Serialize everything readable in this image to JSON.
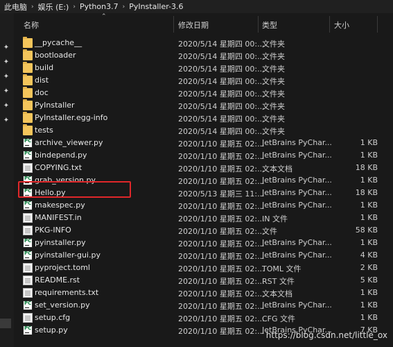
{
  "breadcrumb": [
    "此电脑",
    "娱乐 (E:)",
    "Python3.7",
    "PyInstaller-3.6"
  ],
  "header": {
    "name": "名称",
    "date": "修改日期",
    "type": "类型",
    "size": "大小"
  },
  "files": [
    {
      "name": "__pycache__",
      "date": "2020/5/14 星期四 00:...",
      "type": "文件夹",
      "size": "",
      "icon": "folder-icon"
    },
    {
      "name": "bootloader",
      "date": "2020/5/14 星期四 00:...",
      "type": "文件夹",
      "size": "",
      "icon": "folder-icon"
    },
    {
      "name": "build",
      "date": "2020/5/14 星期四 00:...",
      "type": "文件夹",
      "size": "",
      "icon": "folder-icon"
    },
    {
      "name": "dist",
      "date": "2020/5/14 星期四 00:...",
      "type": "文件夹",
      "size": "",
      "icon": "folder-icon"
    },
    {
      "name": "doc",
      "date": "2020/5/14 星期四 00:...",
      "type": "文件夹",
      "size": "",
      "icon": "folder-icon"
    },
    {
      "name": "PyInstaller",
      "date": "2020/5/14 星期四 00:...",
      "type": "文件夹",
      "size": "",
      "icon": "folder-icon"
    },
    {
      "name": "PyInstaller.egg-info",
      "date": "2020/5/14 星期四 00:...",
      "type": "文件夹",
      "size": "",
      "icon": "folder-icon"
    },
    {
      "name": "tests",
      "date": "2020/5/14 星期四 00:...",
      "type": "文件夹",
      "size": "",
      "icon": "folder-icon"
    },
    {
      "name": "archive_viewer.py",
      "date": "2020/1/10 星期五 02:...",
      "type": "JetBrains PyChar...",
      "size": "1 KB",
      "icon": "pycharm-file-icon"
    },
    {
      "name": "bindepend.py",
      "date": "2020/1/10 星期五 02:...",
      "type": "JetBrains PyChar...",
      "size": "1 KB",
      "icon": "pycharm-file-icon"
    },
    {
      "name": "COPYING.txt",
      "date": "2020/1/10 星期五 02:...",
      "type": "文本文档",
      "size": "18 KB",
      "icon": "text-file-icon"
    },
    {
      "name": "grab_version.py",
      "date": "2020/1/10 星期五 02:...",
      "type": "JetBrains PyChar...",
      "size": "1 KB",
      "icon": "pycharm-file-icon"
    },
    {
      "name": "Hello.py",
      "date": "2020/5/13 星期三 11:...",
      "type": "JetBrains PyChar...",
      "size": "18 KB",
      "icon": "pycharm-file-icon"
    },
    {
      "name": "makespec.py",
      "date": "2020/1/10 星期五 02:...",
      "type": "JetBrains PyChar...",
      "size": "1 KB",
      "icon": "pycharm-file-icon"
    },
    {
      "name": "MANIFEST.in",
      "date": "2020/1/10 星期五 02:...",
      "type": "IN 文件",
      "size": "1 KB",
      "icon": "document-icon"
    },
    {
      "name": "PKG-INFO",
      "date": "2020/1/10 星期五 02:...",
      "type": "文件",
      "size": "58 KB",
      "icon": "document-icon"
    },
    {
      "name": "pyinstaller.py",
      "date": "2020/1/10 星期五 02:...",
      "type": "JetBrains PyChar...",
      "size": "1 KB",
      "icon": "pycharm-file-icon"
    },
    {
      "name": "pyinstaller-gui.py",
      "date": "2020/1/10 星期五 02:...",
      "type": "JetBrains PyChar...",
      "size": "4 KB",
      "icon": "pycharm-file-icon"
    },
    {
      "name": "pyproject.toml",
      "date": "2020/1/10 星期五 02:...",
      "type": "TOML 文件",
      "size": "2 KB",
      "icon": "document-icon"
    },
    {
      "name": "README.rst",
      "date": "2020/1/10 星期五 02:...",
      "type": "RST 文件",
      "size": "5 KB",
      "icon": "document-icon"
    },
    {
      "name": "requirements.txt",
      "date": "2020/1/10 星期五 02:...",
      "type": "文本文档",
      "size": "1 KB",
      "icon": "text-file-icon"
    },
    {
      "name": "set_version.py",
      "date": "2020/1/10 星期五 02:...",
      "type": "JetBrains PyChar...",
      "size": "1 KB",
      "icon": "pycharm-file-icon"
    },
    {
      "name": "setup.cfg",
      "date": "2020/1/10 星期五 02:...",
      "type": "CFG 文件",
      "size": "1 KB",
      "icon": "settings-file-icon"
    },
    {
      "name": "setup.py",
      "date": "2020/1/10 星期五 02:...",
      "type": "JetBrains PyChar...",
      "size": "7 KB",
      "icon": "pycharm-file-icon"
    }
  ],
  "watermark": "https://blog.csdn.net/little_ox",
  "colors": {
    "highlight": "#e0272a",
    "background": "#191919",
    "folder": "#f4c55b"
  }
}
